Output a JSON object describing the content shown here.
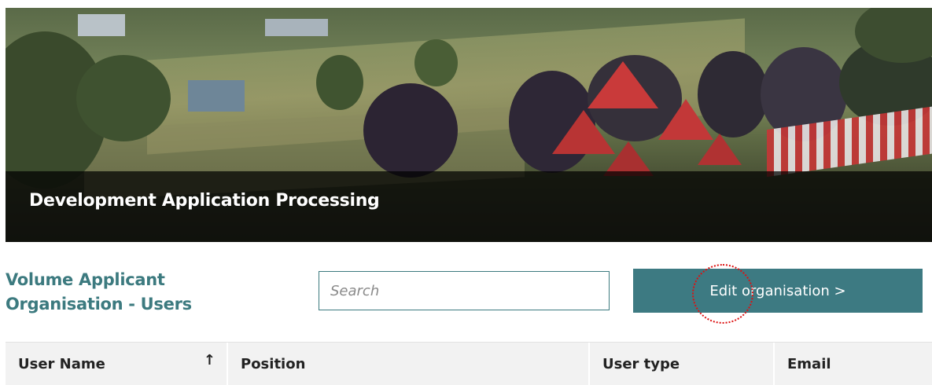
{
  "hero": {
    "title": "Development Application Processing"
  },
  "organisation": {
    "title": "Volume Applicant Organisation - Users"
  },
  "search": {
    "placeholder": "Search",
    "value": ""
  },
  "actions": {
    "edit_label": "Edit organisation >"
  },
  "table": {
    "columns": [
      {
        "label": "User Name",
        "sorted": "ascending",
        "sort_icon": "sort-ascending-arrow"
      },
      {
        "label": "Position"
      },
      {
        "label": "User type"
      },
      {
        "label": "Email"
      }
    ]
  },
  "colors": {
    "accent": "#3c7a7f",
    "button": "#3d7a82",
    "banner_overlay": "#000000",
    "highlight_marker": "#dd1111"
  }
}
